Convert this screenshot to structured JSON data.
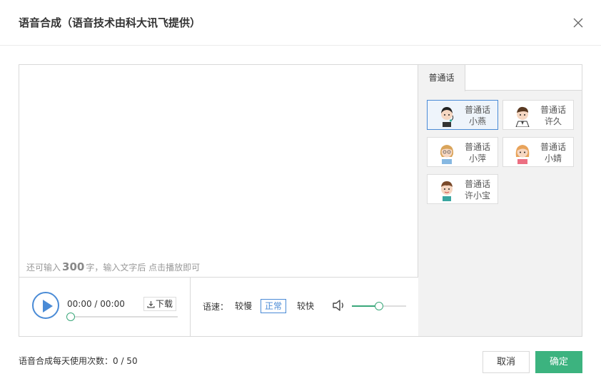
{
  "dialog": {
    "title": "语音合成（语音技术由科大讯飞提供）",
    "close_icon": "close-icon"
  },
  "editor": {
    "text_value": "",
    "hint_prefix": "还可输入",
    "hint_count": "300",
    "hint_suffix": "字，输入文字后 点击播放即可"
  },
  "player": {
    "play_icon": "play-icon",
    "time": "00:00 / 00:00",
    "download_label": "下载",
    "progress": 0
  },
  "speed": {
    "label": "语速：",
    "options": [
      "较慢",
      "正常",
      "较快"
    ],
    "selected": "正常",
    "volume_icon": "volume-icon",
    "volume_level": 0.5
  },
  "voices": {
    "tab": "普通话",
    "items": [
      {
        "lang": "普通话",
        "name": "小燕",
        "active": true
      },
      {
        "lang": "普通话",
        "name": "许久",
        "active": false
      },
      {
        "lang": "普通话",
        "name": "小萍",
        "active": false
      },
      {
        "lang": "普通话",
        "name": "小婧",
        "active": false
      },
      {
        "lang": "普通话",
        "name": "许小宝",
        "active": false
      }
    ]
  },
  "footer": {
    "usage_text": "语音合成每天使用次数：0 / 50",
    "cancel_label": "取消",
    "ok_label": "确定"
  },
  "colors": {
    "accent_blue": "#4a8bd6",
    "accent_green": "#3cb37f"
  }
}
